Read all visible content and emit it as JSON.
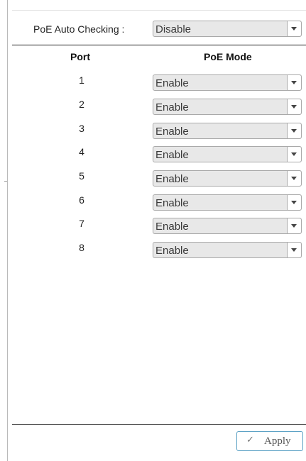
{
  "auto_checking": {
    "label": "PoE Auto Checking :",
    "value": "Disable"
  },
  "table": {
    "headers": {
      "port": "Port",
      "mode": "PoE Mode"
    },
    "rows": [
      {
        "port": "1",
        "mode": "Enable"
      },
      {
        "port": "2",
        "mode": "Enable"
      },
      {
        "port": "3",
        "mode": "Enable"
      },
      {
        "port": "4",
        "mode": "Enable"
      },
      {
        "port": "5",
        "mode": "Enable"
      },
      {
        "port": "6",
        "mode": "Enable"
      },
      {
        "port": "7",
        "mode": "Enable"
      },
      {
        "port": "8",
        "mode": "Enable"
      }
    ]
  },
  "apply_button": {
    "label": "Apply",
    "icon": "check-icon"
  }
}
